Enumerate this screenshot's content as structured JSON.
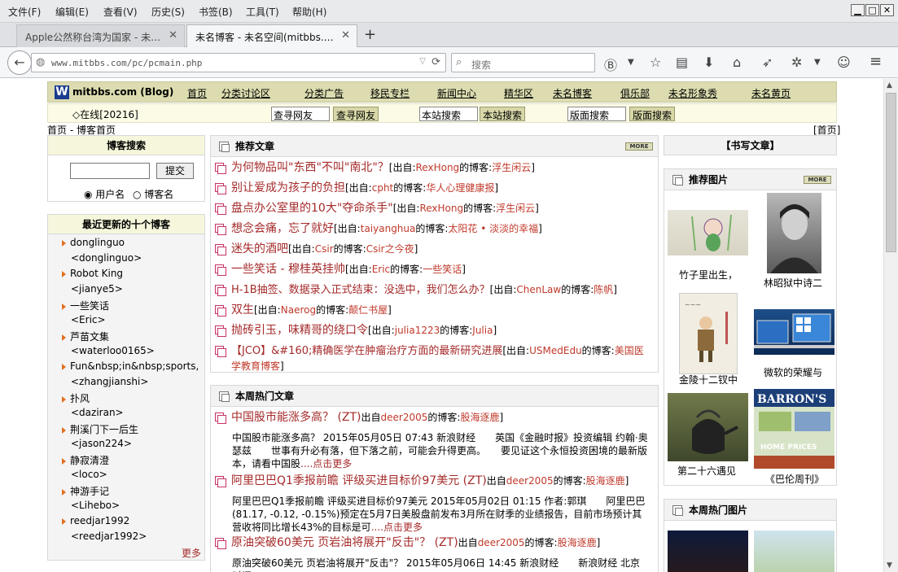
{
  "menubar": {
    "items": [
      "文件(F)",
      "编辑(E)",
      "查看(V)",
      "历史(S)",
      "书签(B)",
      "工具(T)",
      "帮助(H)"
    ],
    "controls": {
      "minimize": "▁",
      "maximize": "□",
      "close": "✕"
    }
  },
  "tabs": [
    {
      "title": "Apple公然称台湾为国家 - 未…",
      "close": "✕"
    },
    {
      "title": "未名博客 - 未名空间(mitbbs.…",
      "close": "✕"
    }
  ],
  "newtab": "+",
  "address": {
    "url": "www.mitbbs.com/pc/pcmain.php",
    "reload": "⟳",
    "dropdown": "▽"
  },
  "search": {
    "placeholder": "搜索"
  },
  "toolbar_icons": [
    "reader-icon",
    "star-icon",
    "library-icon",
    "download-icon",
    "home-icon",
    "send-icon",
    "extension-icon",
    "emoji-icon",
    "menu-icon"
  ],
  "site": {
    "logo": "W",
    "name": "mitbbs.com (Blog)",
    "nav": [
      "首页",
      "分类讨论区",
      "分类广告",
      "移民专栏",
      "新闻中心",
      "精华区",
      "未名博客",
      "俱乐部",
      "未名形象秀",
      "未名黄页"
    ],
    "online": "◇在线[20216]",
    "search1": {
      "value": "查寻网友",
      "button": "查寻网友"
    },
    "search2": {
      "value": "本站搜索",
      "button": "本站搜索"
    },
    "search3": {
      "value": "版面搜索",
      "button": "版面搜索"
    },
    "breadcrumb": "首页 - 博客首页",
    "firstpage": "[首页]"
  },
  "blog_search": {
    "title": "博客搜索",
    "button": "提交",
    "radio1": "用户名",
    "radio2": "博客名"
  },
  "recent": {
    "title": "最近更新的十个博客",
    "more": "更多",
    "items": [
      {
        "name": "donglinguo",
        "user": "<donglinguo>"
      },
      {
        "name": "Robot King",
        "user": "<jianye5>"
      },
      {
        "name": "一些笑话",
        "user": "<Eric>"
      },
      {
        "name": "芦苗文集",
        "user": "<waterloo0165>"
      },
      {
        "name": "Fun&nbsp;in&nbsp;sports,",
        "user": "<zhangjianshi>"
      },
      {
        "name": "扑风",
        "user": "<daziran>"
      },
      {
        "name": "荆溪门下一后生",
        "user": "<jason224>"
      },
      {
        "name": "静寂清澄",
        "user": "<loco>"
      },
      {
        "name": "神游手记",
        "user": "<Lihebo>"
      },
      {
        "name": "reedjar1992",
        "user": "<reedjar1992>"
      }
    ]
  },
  "recommended": {
    "title": "推荐文章",
    "more": "MORE",
    "from": "[出自:",
    "of": "的博客:",
    "end": "]",
    "articles": [
      {
        "title": "为何物品叫\"东西\"不叫\"南北\"？",
        "author": "RexHong",
        "blog": "浮生闲云"
      },
      {
        "title": "别让爱成为孩子的负担",
        "author": "cpht",
        "blog": "华人心理健康报"
      },
      {
        "title": "盘点办公室里的10大\"夺命杀手\"",
        "author": "RexHong",
        "blog": "浮生闲云"
      },
      {
        "title": "想念会痛，忘了就好",
        "author": "taiyanghua",
        "blog": "太阳花 • 淡淡的幸福"
      },
      {
        "title": "迷失的酒吧",
        "author": "Csir",
        "blog": "Csir之今夜"
      },
      {
        "title": "一些笑话 - 穆桂英挂帅",
        "author": "Eric",
        "blog": "一些笑话"
      },
      {
        "title": "H-1B抽签、数据录入正式结束：没选中，我们怎么办？",
        "author": "ChenLaw",
        "blog": "陈帆"
      },
      {
        "title": "双生",
        "author": "Naerog",
        "blog": "颠仁书屋"
      },
      {
        "title": "抛砖引玉，味精哥的绕口令",
        "author": "julia1223",
        "blog": "Julia"
      },
      {
        "title": "【JCO】&#160;精确医学在肿瘤治疗方面的最新研究进展",
        "author": "USMedEdu",
        "blog": "美国医学教育博客"
      }
    ]
  },
  "hot": {
    "title": "本周热门文章",
    "from": "出自",
    "of": "的博客:",
    "more_link": "....点击更多",
    "articles": [
      {
        "title": "中国股市能涨多高？ (ZT)",
        "author": "deer2005",
        "blog": "股海逐鹿",
        "snippet": "中国股市能涨多高？ 2015年05月05日 07:43 新浪财经　　英国《金融时报》投资编辑 约翰·奥瑟兹　　世事有升必有落，但下落之前，可能会升得更高。　　要见证这个永恒投资困境的最新版本，请看中国股"
      },
      {
        "title": "阿里巴巴Q1季报前瞻 评级买进目标价97美元 (ZT)",
        "author": "deer2005",
        "blog": "股海逐鹿",
        "snippet": "阿里巴巴Q1季报前瞻 评级买进目标价97美元 2015年05月02日 01:15 作者:郭琪　　阿里巴巴(81.17, -0.12, -0.15%)预定在5月7日美股盘前发布3月所在财季的业绩报告，目前市场预计其营收将同比增长43%的目标是可"
      },
      {
        "title": "原油突破60美元 页岩油将展开\"反击\"？ (ZT)",
        "author": "deer2005",
        "blog": "股海逐鹿",
        "snippet": "原油突破60美元 页岩油将展开\"反击\"？ 2015年05月06日 14:45 新浪财经　　新浪财经 北京时间5"
      }
    ]
  },
  "right": {
    "write": "【书写文章】",
    "pics_title": "推荐图片",
    "more": "MORE",
    "pics": [
      "竹子里出生，",
      "林昭狱中诗二",
      "金陵十二钗中",
      "微软的荣耀与",
      "第二十六遇见",
      "《巴伦周刊》"
    ],
    "hot_pics_title": "本周热门图片"
  }
}
